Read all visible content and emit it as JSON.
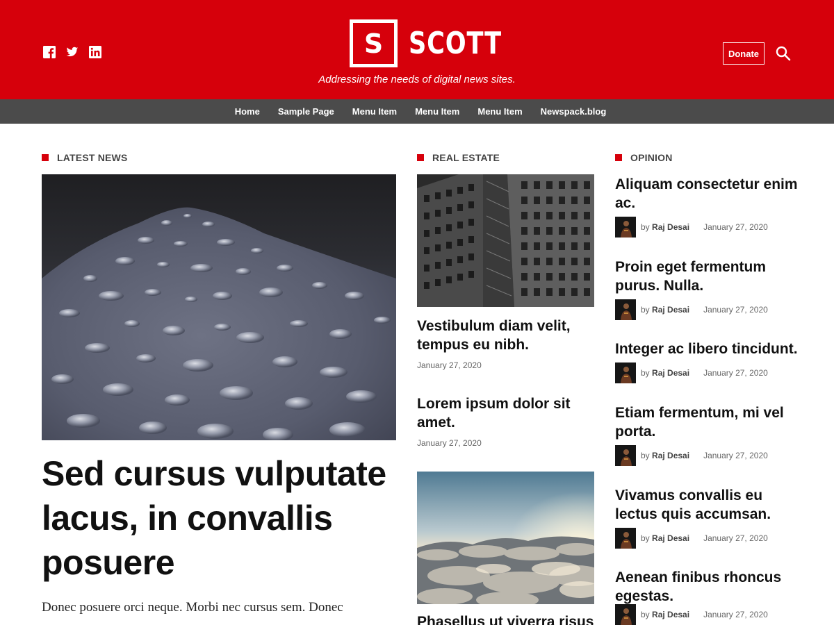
{
  "header": {
    "logo_letter": "S",
    "site_name": "SCOTT",
    "tagline": "Addressing the needs of digital news sites.",
    "donate_label": "Donate",
    "brand_color": "#d6000b",
    "social_icons": [
      "facebook-icon",
      "twitter-icon",
      "linkedin-icon"
    ]
  },
  "nav": {
    "items": [
      "Home",
      "Sample Page",
      "Menu Item",
      "Menu Item",
      "Menu Item",
      "Newspack.blog"
    ]
  },
  "sections": {
    "latest": "LATEST NEWS",
    "realestate": "REAL ESTATE",
    "opinion": "OPINION"
  },
  "feature": {
    "title": "Sed cursus vulputate lacus, in convallis posuere",
    "excerpt": "Donec posuere orci neque. Morbi nec cursus sem. Donec"
  },
  "realestate": [
    {
      "title": "Vestibulum diam velit, tempus eu nibh.",
      "date": "January 27, 2020"
    },
    {
      "title": "Lorem ipsum dolor sit amet.",
      "date": "January 27, 2020"
    },
    {
      "title": "Phasellus ut viverra risus"
    }
  ],
  "opinion": {
    "by": "by",
    "items": [
      {
        "title": "Aliquam consectetur enim ac.",
        "author": "Raj Desai",
        "date": "January 27, 2020"
      },
      {
        "title": "Proin eget fermentum purus. Nulla.",
        "author": "Raj Desai",
        "date": "January 27, 2020"
      },
      {
        "title": "Integer ac libero tincidunt.",
        "author": "Raj Desai",
        "date": "January 27, 2020"
      },
      {
        "title": "Etiam fermentum, mi vel porta.",
        "author": "Raj Desai",
        "date": "January 27, 2020"
      },
      {
        "title": "Vivamus convallis eu lectus quis accumsan.",
        "author": "Raj Desai",
        "date": "January 27, 2020"
      },
      {
        "title": "Aenean finibus rhoncus egestas.",
        "author": "Raj Desai",
        "date": "January 27, 2020"
      }
    ]
  }
}
